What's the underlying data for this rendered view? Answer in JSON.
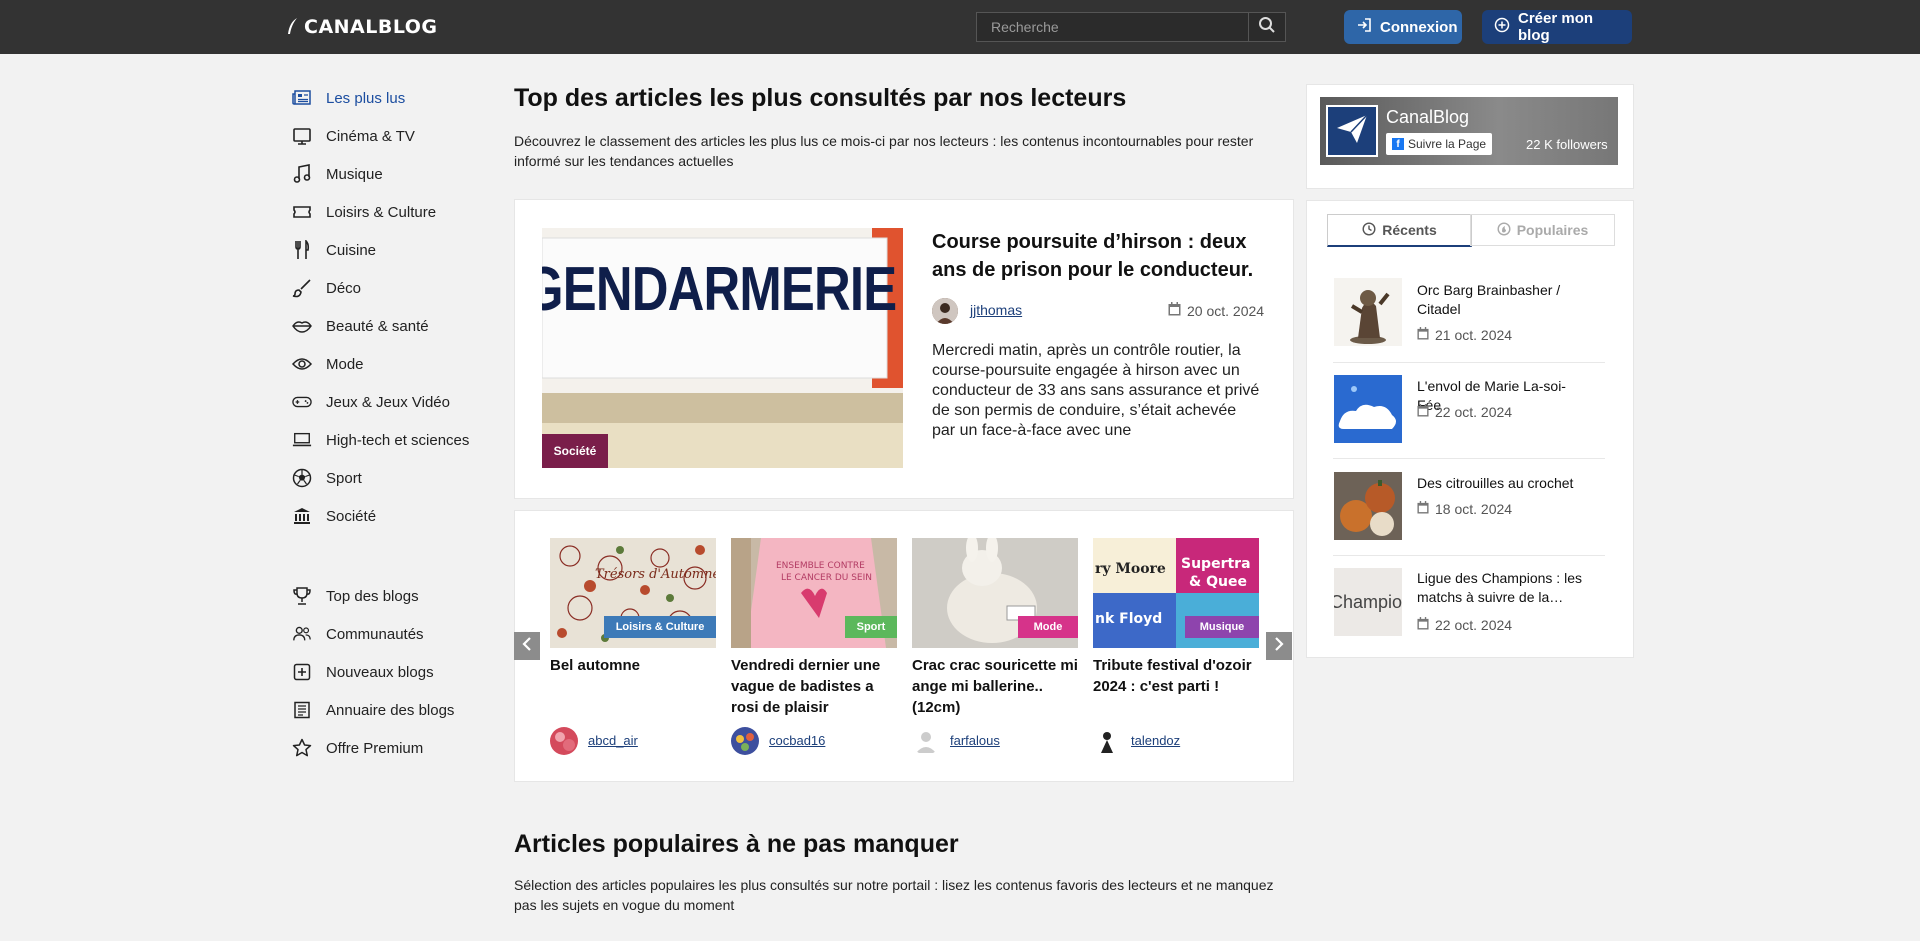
{
  "header": {
    "logo_text": "CANALBLOG",
    "search_placeholder": "Recherche",
    "login_label": "Connexion",
    "create_blog_label": "Créer mon blog"
  },
  "sidebar": {
    "categories": [
      {
        "label": "Les plus lus",
        "icon": "newspaper-icon",
        "active": true
      },
      {
        "label": "Cinéma & TV",
        "icon": "tv-icon"
      },
      {
        "label": "Musique",
        "icon": "music-note-icon"
      },
      {
        "label": "Loisirs & Culture",
        "icon": "ticket-icon"
      },
      {
        "label": "Cuisine",
        "icon": "utensils-icon"
      },
      {
        "label": "Déco",
        "icon": "paint-brush-icon"
      },
      {
        "label": "Beauté & santé",
        "icon": "lips-icon"
      },
      {
        "label": "Mode",
        "icon": "eye-icon"
      },
      {
        "label": "Jeux & Jeux Vidéo",
        "icon": "gamepad-icon"
      },
      {
        "label": "High-tech et sciences",
        "icon": "laptop-icon"
      },
      {
        "label": "Sport",
        "icon": "soccer-ball-icon"
      },
      {
        "label": "Société",
        "icon": "institution-icon"
      }
    ],
    "links": [
      {
        "label": "Top des blogs",
        "icon": "trophy-icon"
      },
      {
        "label": "Communautés",
        "icon": "users-icon"
      },
      {
        "label": "Nouveaux blogs",
        "icon": "plus-square-icon"
      },
      {
        "label": "Annuaire des blogs",
        "icon": "list-book-icon"
      },
      {
        "label": "Offre Premium",
        "icon": "star-icon"
      }
    ]
  },
  "main": {
    "title": "Top des articles les plus consultés par nos lecteurs",
    "lead": "Découvrez le classement des articles les plus lus ce mois-ci par nos lecteurs : les contenus incontournables pour rester informé sur les tendances actuelles",
    "featured": {
      "image_text": "GENDARMERIE",
      "badge": "Société",
      "title": "Course poursuite d’hirson : deux ans de prison pour le conducteur.",
      "author": "jjthomas",
      "date": "20 oct. 2024",
      "excerpt": "Mercredi matin, après un contrôle routier, la course-poursuite engagée à hirson avec un conducteur de 33 ans sans assurance et privé de son permis de conduire, s’était achevée par un face-à-face avec une"
    },
    "carousel": [
      {
        "title": "Bel automne",
        "badge": "Loisirs & Culture",
        "badge_color": "#3d7ab8",
        "author": "abcd_air"
      },
      {
        "title": "Vendredi dernier une vague de badistes a rosi de plaisir",
        "badge": "Sport",
        "badge_color": "#5cb85c",
        "author": "cocbad16"
      },
      {
        "title": "Crac crac souricette mi ange mi ballerine.. (12cm)",
        "badge": "Mode",
        "badge_color": "#d6338a",
        "author": "farfalous"
      },
      {
        "title": "Tribute festival d'ozoir 2024 : c'est parti !",
        "badge": "Musique",
        "badge_color": "#8e44ad",
        "author": "talendoz"
      }
    ],
    "section2_title": "Articles populaires à ne pas manquer",
    "section2_lead": "Sélection des articles populaires les plus consultés sur notre portail : lisez les contenus favoris des lecteurs et ne manquez pas les sujets en vogue du moment"
  },
  "facebook": {
    "name": "CanalBlog",
    "follow_label": "Suivre la Page",
    "followers": "22 K followers"
  },
  "tabs": {
    "recent": "Récents",
    "popular": "Populaires"
  },
  "recent": [
    {
      "title": "Orc Barg Brainbasher / Citadel",
      "date": "21 oct. 2024"
    },
    {
      "title": "L'envol de Marie La-soi-Fée",
      "date": "22 oct. 2024"
    },
    {
      "title": "Des citrouilles au crochet",
      "date": "18 oct. 2024"
    },
    {
      "title": "Ligue des Champions : les matchs à suivre de la…",
      "date": "22 oct. 2024"
    }
  ],
  "recent_thumb_text": "Champio"
}
